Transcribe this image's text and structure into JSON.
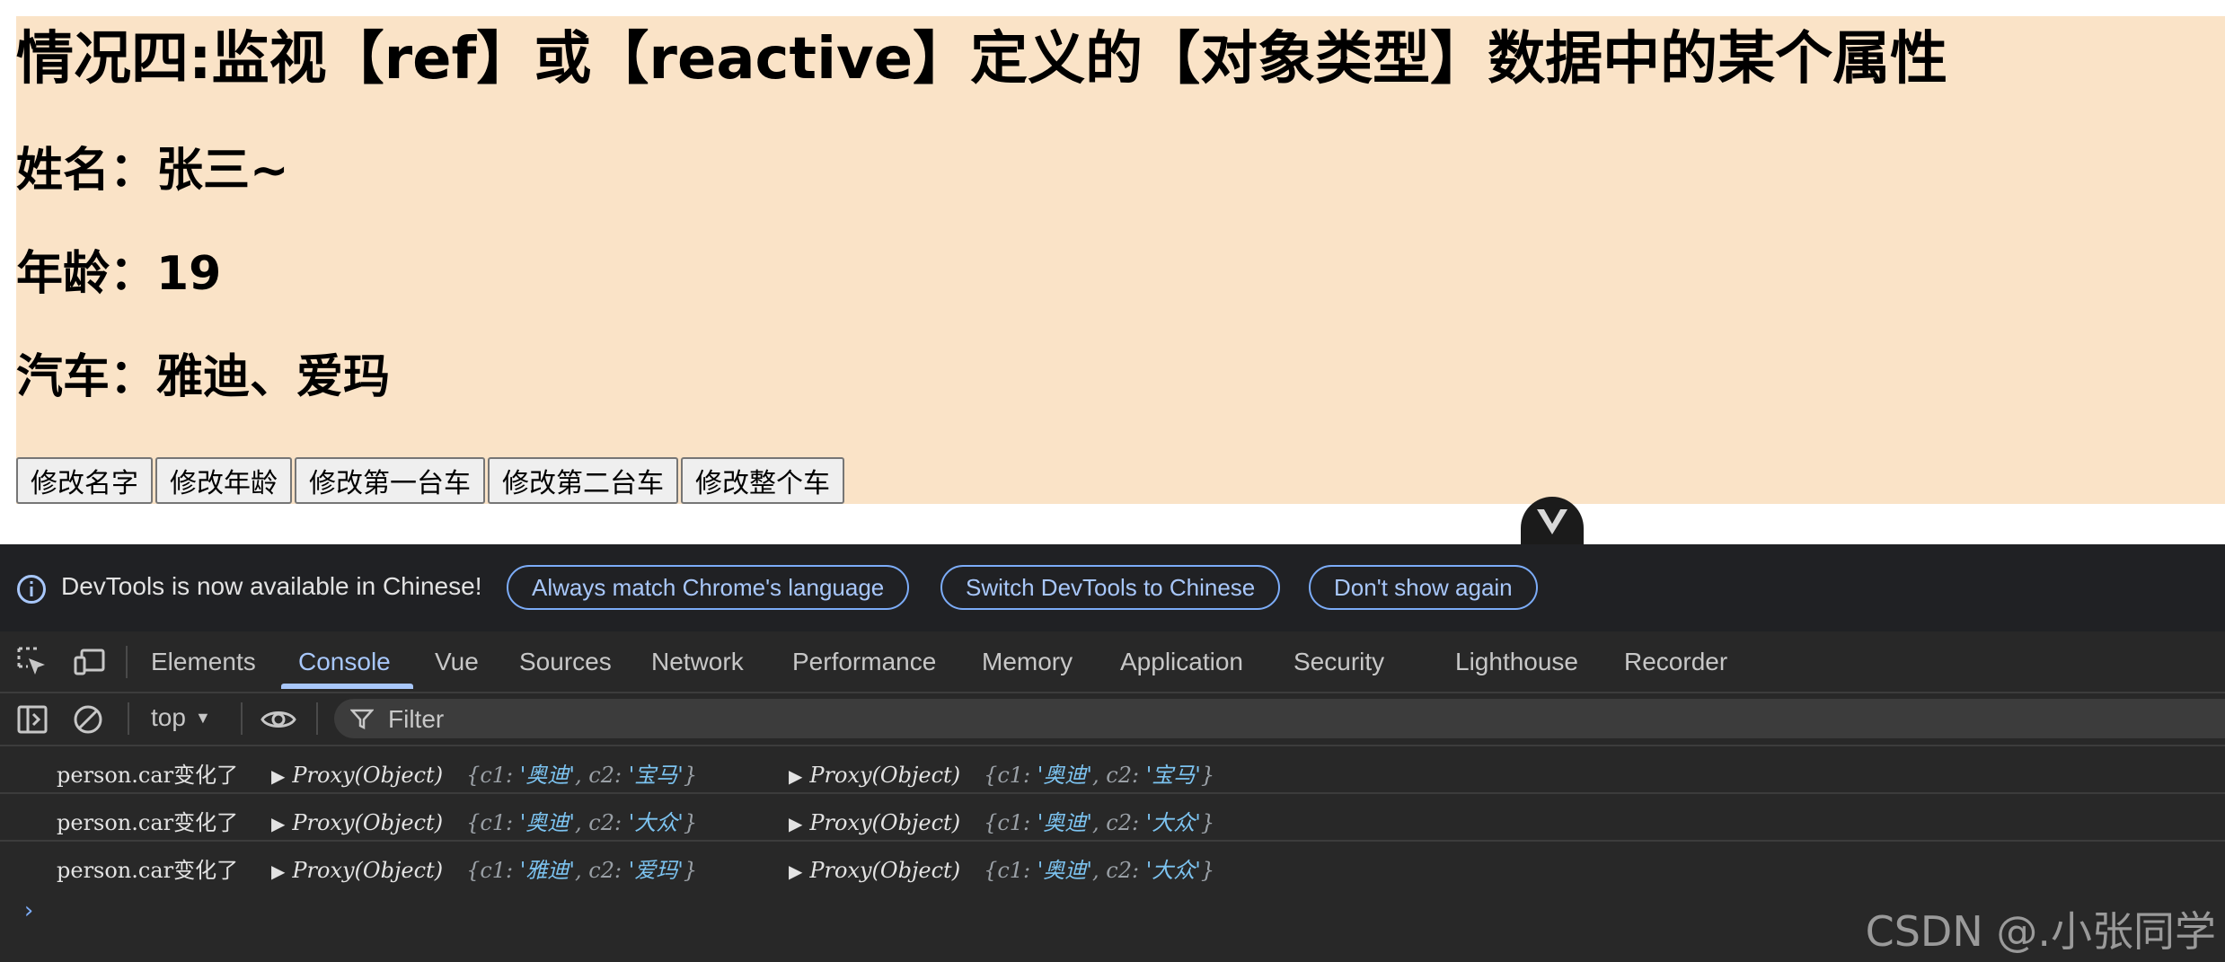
{
  "page": {
    "title": "情况四:监视【ref】或【reactive】定义的【对象类型】数据中的某个属性",
    "name_line": "姓名：张三~",
    "age_line": "年龄：19",
    "car_line": "汽车：雅迪、爱玛",
    "buttons": [
      "修改名字",
      "修改年龄",
      "修改第一台车",
      "修改第二台车",
      "修改整个车"
    ],
    "background_color": "#fae3c7"
  },
  "vue_tab": {
    "icon": "vue-logo-icon"
  },
  "infobar": {
    "icon": "info-icon",
    "text": "DevTools is now available in Chinese!",
    "buttons": [
      "Always match Chrome's language",
      "Switch DevTools to Chinese",
      "Don't show again"
    ]
  },
  "tabs": [
    "Elements",
    "Console",
    "Vue",
    "Sources",
    "Network",
    "Performance",
    "Memory",
    "Application",
    "Security",
    "Lighthouse",
    "Recorder"
  ],
  "active_tab": "Console",
  "toolbar": {
    "context": "top",
    "filter_placeholder": "Filter"
  },
  "console": {
    "logs": [
      {
        "message": "person.car变化了",
        "new": {
          "label": "Proxy(Object)",
          "c1": "'奥迪'",
          "c2": "'宝马'"
        },
        "old": {
          "label": "Proxy(Object)",
          "c1": "'奥迪'",
          "c2": "'宝马'"
        }
      },
      {
        "message": "person.car变化了",
        "new": {
          "label": "Proxy(Object)",
          "c1": "'奥迪'",
          "c2": "'大众'"
        },
        "old": {
          "label": "Proxy(Object)",
          "c1": "'奥迪'",
          "c2": "'大众'"
        }
      },
      {
        "message": "person.car变化了",
        "new": {
          "label": "Proxy(Object)",
          "c1": "'雅迪'",
          "c2": "'爱玛'"
        },
        "old": {
          "label": "Proxy(Object)",
          "c1": "'奥迪'",
          "c2": "'大众'"
        }
      }
    ],
    "prompt": "›"
  },
  "watermark": "CSDN @.小张同学",
  "colors": {
    "devtools_bg": "#282828",
    "accent_blue": "#a8c7fa",
    "string_value": "#7cc3f0"
  }
}
